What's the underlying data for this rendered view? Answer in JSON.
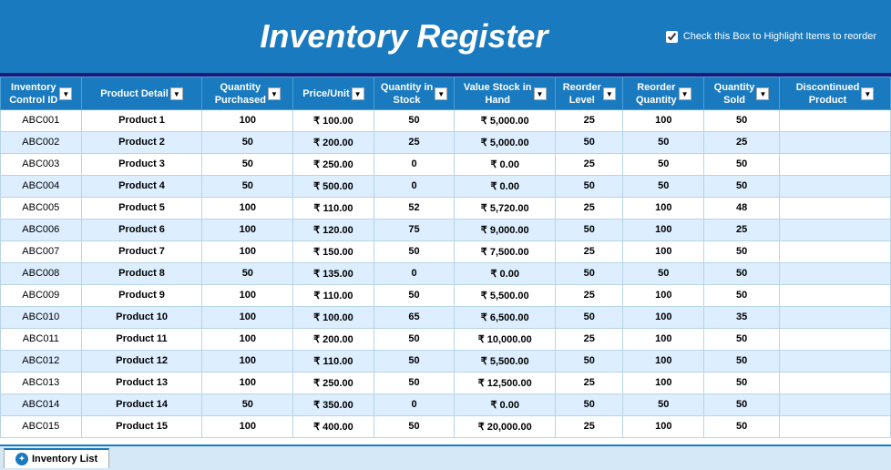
{
  "header": {
    "title": "Inventory Register",
    "checkbox_label": "Check this Box to Highlight Items to reorder",
    "checkbox_checked": true
  },
  "columns": [
    {
      "id": "col-id",
      "label": "Inventory\nControl ID"
    },
    {
      "id": "col-prod",
      "label": "Product Detail"
    },
    {
      "id": "col-qp",
      "label": "Quantity\nPurchased"
    },
    {
      "id": "col-pu",
      "label": "Price/Unit"
    },
    {
      "id": "col-qs",
      "label": "Quantity in\nStock"
    },
    {
      "id": "col-vs",
      "label": "Value Stock in\nHand"
    },
    {
      "id": "col-rl",
      "label": "Reorder\nLevel"
    },
    {
      "id": "col-rq",
      "label": "Reorder\nQuantity"
    },
    {
      "id": "col-sold",
      "label": "Quantity\nSold"
    },
    {
      "id": "col-disc",
      "label": "Discontinued\nProduct"
    }
  ],
  "rows": [
    {
      "id": "ABC001",
      "product": "Product 1",
      "qty_purchased": 100,
      "price": "₹ 100.00",
      "qty_stock": 50,
      "value_stock": "₹ 5,000.00",
      "reorder_level": 25,
      "reorder_qty": 100,
      "qty_sold": 50,
      "discontinued": ""
    },
    {
      "id": "ABC002",
      "product": "Product 2",
      "qty_purchased": 50,
      "price": "₹ 200.00",
      "qty_stock": 25,
      "value_stock": "₹ 5,000.00",
      "reorder_level": 50,
      "reorder_qty": 50,
      "qty_sold": 25,
      "discontinued": ""
    },
    {
      "id": "ABC003",
      "product": "Product 3",
      "qty_purchased": 50,
      "price": "₹ 250.00",
      "qty_stock": 0,
      "value_stock": "₹ 0.00",
      "reorder_level": 25,
      "reorder_qty": 50,
      "qty_sold": 50,
      "discontinued": ""
    },
    {
      "id": "ABC004",
      "product": "Product 4",
      "qty_purchased": 50,
      "price": "₹ 500.00",
      "qty_stock": 0,
      "value_stock": "₹ 0.00",
      "reorder_level": 50,
      "reorder_qty": 50,
      "qty_sold": 50,
      "discontinued": ""
    },
    {
      "id": "ABC005",
      "product": "Product 5",
      "qty_purchased": 100,
      "price": "₹ 110.00",
      "qty_stock": 52,
      "value_stock": "₹ 5,720.00",
      "reorder_level": 25,
      "reorder_qty": 100,
      "qty_sold": 48,
      "discontinued": ""
    },
    {
      "id": "ABC006",
      "product": "Product 6",
      "qty_purchased": 100,
      "price": "₹ 120.00",
      "qty_stock": 75,
      "value_stock": "₹ 9,000.00",
      "reorder_level": 50,
      "reorder_qty": 100,
      "qty_sold": 25,
      "discontinued": ""
    },
    {
      "id": "ABC007",
      "product": "Product 7",
      "qty_purchased": 100,
      "price": "₹ 150.00",
      "qty_stock": 50,
      "value_stock": "₹ 7,500.00",
      "reorder_level": 25,
      "reorder_qty": 100,
      "qty_sold": 50,
      "discontinued": ""
    },
    {
      "id": "ABC008",
      "product": "Product 8",
      "qty_purchased": 50,
      "price": "₹ 135.00",
      "qty_stock": 0,
      "value_stock": "₹ 0.00",
      "reorder_level": 50,
      "reorder_qty": 50,
      "qty_sold": 50,
      "discontinued": ""
    },
    {
      "id": "ABC009",
      "product": "Product 9",
      "qty_purchased": 100,
      "price": "₹ 110.00",
      "qty_stock": 50,
      "value_stock": "₹ 5,500.00",
      "reorder_level": 25,
      "reorder_qty": 100,
      "qty_sold": 50,
      "discontinued": ""
    },
    {
      "id": "ABC010",
      "product": "Product 10",
      "qty_purchased": 100,
      "price": "₹ 100.00",
      "qty_stock": 65,
      "value_stock": "₹ 6,500.00",
      "reorder_level": 50,
      "reorder_qty": 100,
      "qty_sold": 35,
      "discontinued": ""
    },
    {
      "id": "ABC011",
      "product": "Product 11",
      "qty_purchased": 100,
      "price": "₹ 200.00",
      "qty_stock": 50,
      "value_stock": "₹ 10,000.00",
      "reorder_level": 25,
      "reorder_qty": 100,
      "qty_sold": 50,
      "discontinued": ""
    },
    {
      "id": "ABC012",
      "product": "Product 12",
      "qty_purchased": 100,
      "price": "₹ 110.00",
      "qty_stock": 50,
      "value_stock": "₹ 5,500.00",
      "reorder_level": 50,
      "reorder_qty": 100,
      "qty_sold": 50,
      "discontinued": ""
    },
    {
      "id": "ABC013",
      "product": "Product 13",
      "qty_purchased": 100,
      "price": "₹ 250.00",
      "qty_stock": 50,
      "value_stock": "₹ 12,500.00",
      "reorder_level": 25,
      "reorder_qty": 100,
      "qty_sold": 50,
      "discontinued": ""
    },
    {
      "id": "ABC014",
      "product": "Product 14",
      "qty_purchased": 50,
      "price": "₹ 350.00",
      "qty_stock": 0,
      "value_stock": "₹ 0.00",
      "reorder_level": 50,
      "reorder_qty": 50,
      "qty_sold": 50,
      "discontinued": ""
    },
    {
      "id": "ABC015",
      "product": "Product 15",
      "qty_purchased": 100,
      "price": "₹ 400.00",
      "qty_stock": 50,
      "value_stock": "₹ 20,000.00",
      "reorder_level": 25,
      "reorder_qty": 100,
      "qty_sold": 50,
      "discontinued": ""
    }
  ],
  "tab": {
    "label": "Inventory List"
  }
}
